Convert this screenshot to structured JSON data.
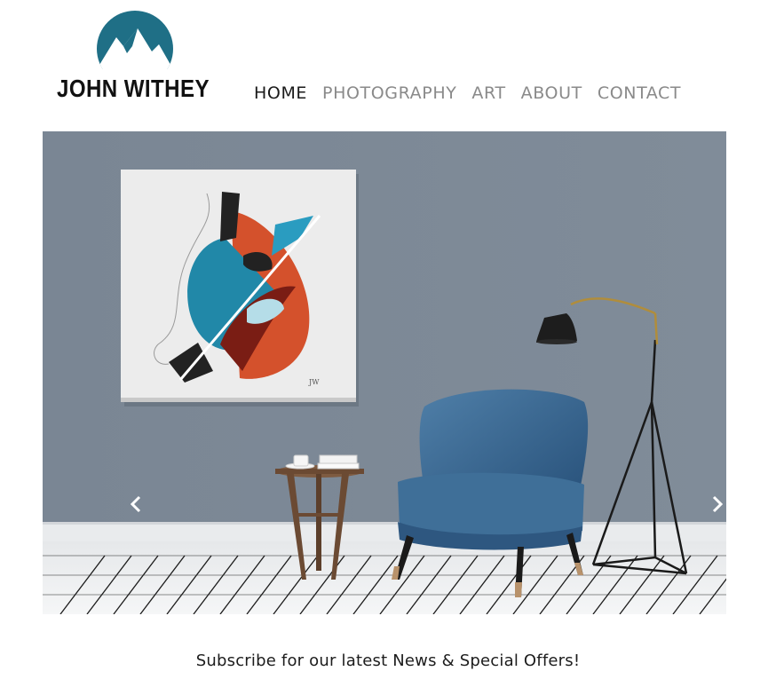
{
  "brand": {
    "name": "JOHN WITHEY",
    "accent_color": "#1f6f86",
    "logo_icon": "mountain-circle-logo"
  },
  "nav": {
    "items": [
      {
        "label": "HOME",
        "active": true
      },
      {
        "label": "PHOTOGRAPHY",
        "active": false
      },
      {
        "label": "ART",
        "active": false
      },
      {
        "label": "ABOUT",
        "active": false
      },
      {
        "label": "CONTACT",
        "active": false
      }
    ],
    "active_color": "#1a1a1a",
    "inactive_color": "#8a8a8a"
  },
  "hero": {
    "wall_color": "#7b8795",
    "signature": "JW",
    "prev_icon": "chevron-left-icon",
    "next_icon": "chevron-right-icon"
  },
  "subscribe": {
    "text": "Subscribe for our latest News & Special Offers!"
  }
}
